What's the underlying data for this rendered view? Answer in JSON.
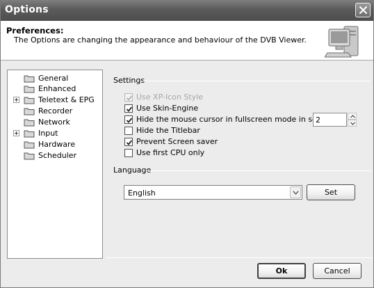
{
  "window": {
    "title": "Options"
  },
  "header": {
    "title": "Preferences:",
    "description": "The Options are changing the appearance and behaviour of the DVB Viewer."
  },
  "tree": {
    "items": [
      {
        "label": "General",
        "expandable": false,
        "selected": true
      },
      {
        "label": "Enhanced",
        "expandable": false,
        "selected": false
      },
      {
        "label": "Teletext & EPG",
        "expandable": true,
        "selected": false
      },
      {
        "label": "Recorder",
        "expandable": false,
        "selected": false
      },
      {
        "label": "Network",
        "expandable": false,
        "selected": false
      },
      {
        "label": "Input",
        "expandable": true,
        "selected": false
      },
      {
        "label": "Hardware",
        "expandable": false,
        "selected": false
      },
      {
        "label": "Scheduler",
        "expandable": false,
        "selected": false
      }
    ]
  },
  "settings": {
    "label": "Settings",
    "options": [
      {
        "label": "Use XP-Icon Style",
        "checked": true,
        "disabled": true
      },
      {
        "label": "Use Skin-Engine",
        "checked": true,
        "disabled": false
      },
      {
        "label": "Hide the mouse cursor in fullscreen mode in secs:",
        "checked": true,
        "disabled": false
      },
      {
        "label": "Hide the Titlebar",
        "checked": false,
        "disabled": false
      },
      {
        "label": "Prevent Screen saver",
        "checked": true,
        "disabled": false
      },
      {
        "label": "Use first CPU only",
        "checked": false,
        "disabled": false
      }
    ],
    "cursor_secs": "2"
  },
  "language": {
    "label": "Language",
    "selected": "English",
    "set_label": "Set"
  },
  "footer": {
    "ok_label": "Ok",
    "cancel_label": "Cancel"
  }
}
